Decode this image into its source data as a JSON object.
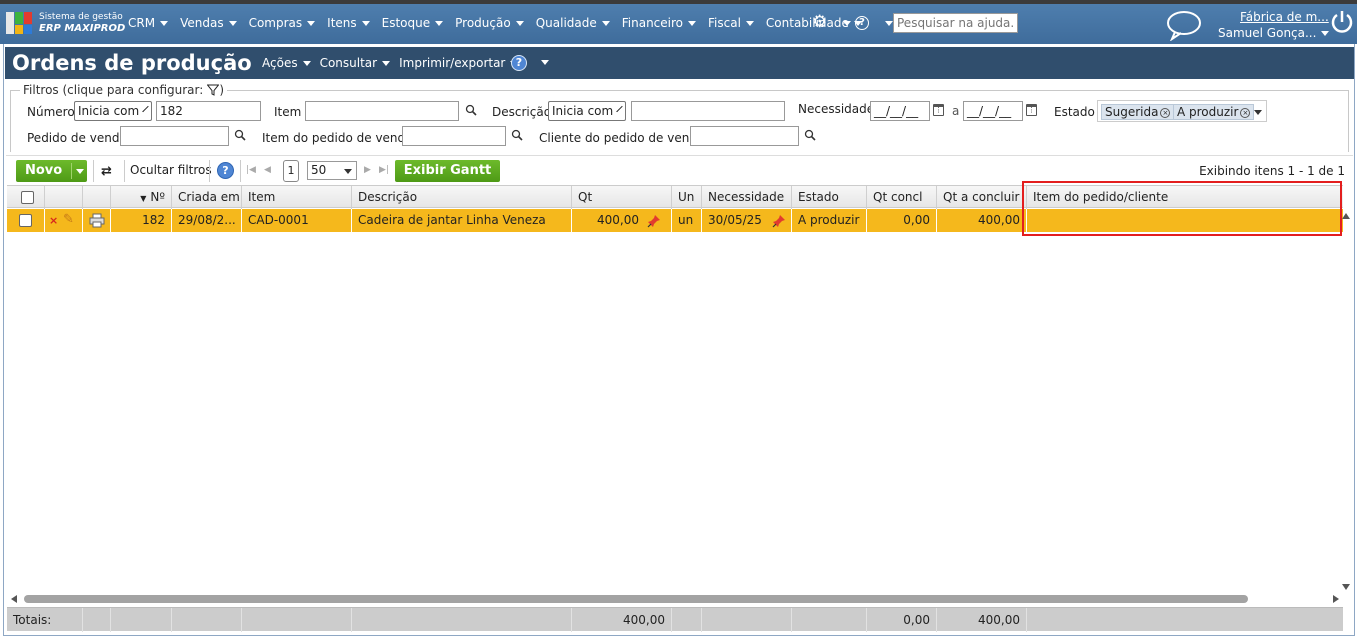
{
  "brand": {
    "line1": "Sistema de gestão",
    "line2": "ERP MAXIPROD"
  },
  "nav": {
    "menu": [
      "CRM",
      "Vendas",
      "Compras",
      "Itens",
      "Estoque",
      "Produção",
      "Qualidade",
      "Financeiro",
      "Fiscal",
      "Contabilidade"
    ],
    "help_placeholder": "Pesquisar na ajuda...",
    "company": "Fábrica de m...",
    "user": "Samuel Gonça..."
  },
  "page": {
    "title": "Ordens de produção",
    "menu": [
      "Ações",
      "Consultar",
      "Imprimir/exportar"
    ]
  },
  "filters": {
    "legend": "Filtros (clique para configurar:",
    "legend_close": ")",
    "numero_label": "Número",
    "numero_mode": "Inicia com",
    "numero_value": "182",
    "item_label": "Item",
    "descricao_label": "Descrição",
    "descricao_mode": "Inicia com",
    "necessidade_label": "Necessidade",
    "date_from": "__/__/__",
    "date_sep": "a",
    "date_to": "__/__/__",
    "estado_label": "Estado",
    "estado_tags": [
      "Sugerida",
      "A produzir"
    ],
    "pedido_label": "Pedido de venda",
    "item_pedido_label": "Item do pedido de venda",
    "cliente_label": "Cliente do pedido de venda"
  },
  "toolbar": {
    "novo": "Novo",
    "hide_filters": "Ocultar filtros",
    "page": "1",
    "page_size": "50",
    "gantt": "Exibir Gantt",
    "showing": "Exibindo itens 1 - 1 de 1"
  },
  "grid": {
    "headers": {
      "num": "Nº",
      "criada": "Criada em",
      "item": "Item",
      "descricao": "Descrição",
      "qt": "Qt",
      "un": "Un",
      "necessidade": "Necessidade",
      "estado": "Estado",
      "qt_concl": "Qt concl",
      "qt_a_concluir": "Qt a concluir",
      "item_pedido": "Item do pedido/cliente"
    },
    "rows": [
      {
        "num": "182",
        "criada": "29/08/2...",
        "item": "CAD-0001",
        "descricao": "Cadeira de jantar Linha Veneza",
        "qt": "400,00",
        "un": "un",
        "necessidade": "30/05/25",
        "estado": "A produzir",
        "qt_concl": "0,00",
        "qt_a_concluir": "400,00",
        "item_pedido": ""
      }
    ]
  },
  "totals": {
    "label": "Totais:",
    "qt": "400,00",
    "qt_concl": "0,00",
    "qt_a_concluir": "400,00"
  },
  "colors": {
    "nav_bg": "#4a7aab",
    "title_bg": "#304e6d",
    "row_highlight": "#f5b81c",
    "button_green": "#5aa81f",
    "annotation_red": "#e31e1e"
  }
}
